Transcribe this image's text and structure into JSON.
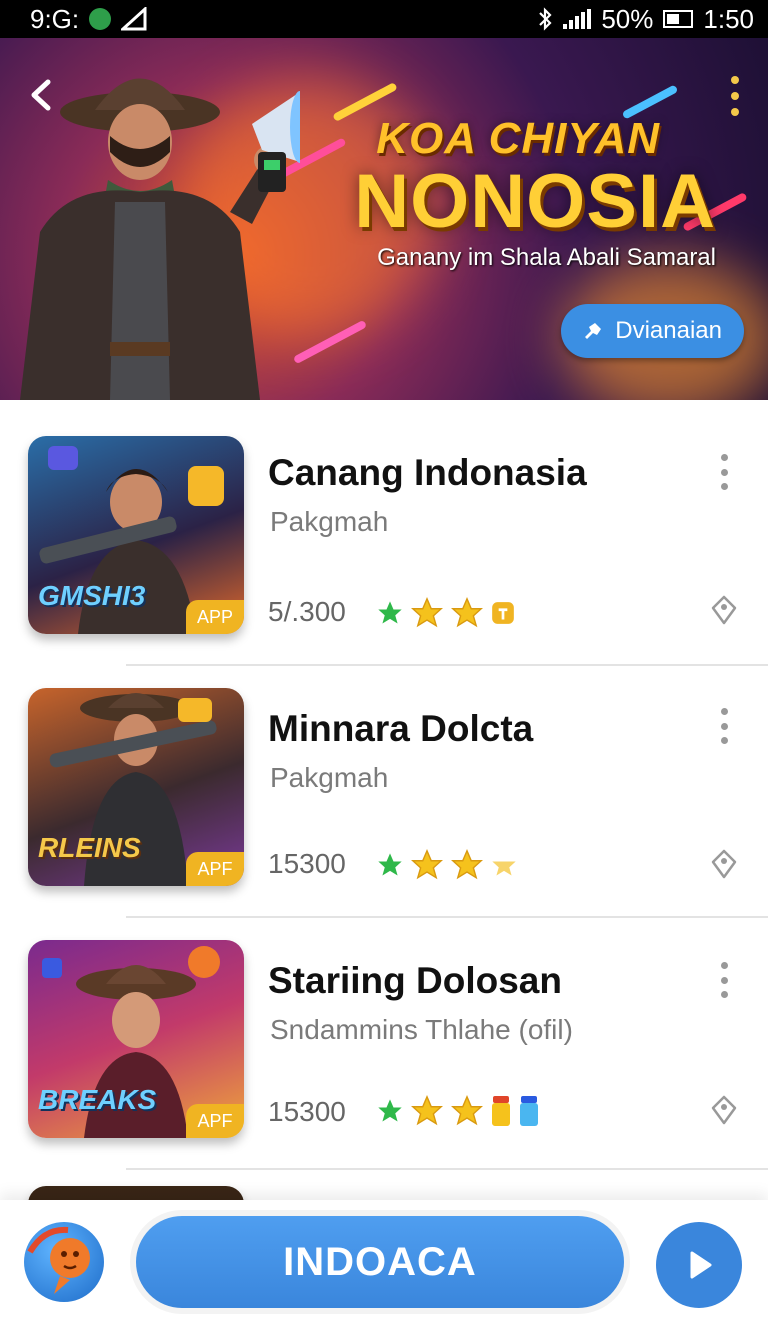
{
  "status_bar": {
    "time_left": "9:G:",
    "battery": "50%",
    "time": "1:50"
  },
  "banner": {
    "title_line1": "KOA CHIYAN",
    "title_line2": "NONOSIA",
    "subtitle": "Ganany im Shala  Abali Samaral",
    "button_label": "Dvianaian"
  },
  "apps": [
    {
      "title": "Canang Indonasia",
      "subtitle": "Pakgmah",
      "count": "5/.300",
      "thumb_label": "GMSHI3",
      "app_tag": "APP"
    },
    {
      "title": "Minnara Dolcta",
      "subtitle": "Pakgmah",
      "count": "15300",
      "thumb_label": "RLEINS",
      "app_tag": "APF"
    },
    {
      "title": "Stariing Dolosan",
      "subtitle": "Sndammins Thlahe (ofil)",
      "count": "15300",
      "thumb_label": "BREAKS",
      "app_tag": "APF"
    }
  ],
  "bottom": {
    "cta_label": "INDOACA"
  },
  "colors": {
    "accent": "#3a86dc",
    "star": "#f5c21c",
    "star_green": "#2fb84a",
    "app_tag": "#f0b422"
  }
}
